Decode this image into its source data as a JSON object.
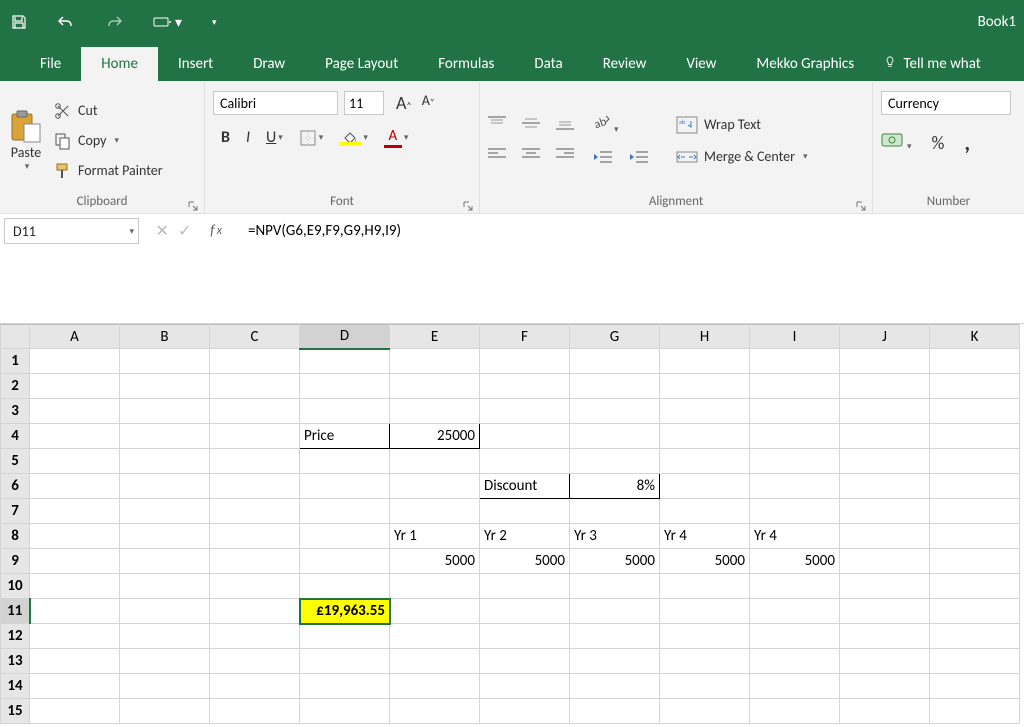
{
  "titlebar": {
    "doc": "Book1"
  },
  "tabs": {
    "file": "File",
    "home": "Home",
    "insert": "Insert",
    "draw": "Draw",
    "page_layout": "Page Layout",
    "formulas": "Formulas",
    "data": "Data",
    "review": "Review",
    "view": "View",
    "mekko": "Mekko Graphics",
    "tell": "Tell me what"
  },
  "ribbon": {
    "clipboard": {
      "paste": "Paste",
      "cut": "Cut",
      "copy": "Copy",
      "painter": "Format Painter",
      "label": "Clipboard"
    },
    "font": {
      "name": "Calibri",
      "size": "11",
      "label": "Font"
    },
    "alignment": {
      "wrap": "Wrap Text",
      "merge": "Merge & Center",
      "label": "Alignment"
    },
    "number": {
      "format": "Currency",
      "label": "Number"
    }
  },
  "fbar": {
    "name": "D11",
    "formula": "=NPV(G6,E9,F9,G9,H9,I9)"
  },
  "columns": [
    "A",
    "B",
    "C",
    "D",
    "E",
    "F",
    "G",
    "H",
    "I",
    "J",
    "K"
  ],
  "rows": 15,
  "cells": {
    "D4": {
      "v": "Price",
      "al": "l",
      "border": true
    },
    "E4": {
      "v": "25000",
      "al": "r",
      "border": true
    },
    "F6": {
      "v": "Discount",
      "al": "l",
      "border": true
    },
    "G6": {
      "v": "8%",
      "al": "r",
      "border": true
    },
    "E8": {
      "v": "Yr 1",
      "al": "l"
    },
    "F8": {
      "v": "Yr 2",
      "al": "l"
    },
    "G8": {
      "v": "Yr 3",
      "al": "l"
    },
    "H8": {
      "v": "Yr 4",
      "al": "l"
    },
    "I8": {
      "v": "Yr 4",
      "al": "l"
    },
    "E9": {
      "v": "5000",
      "al": "r"
    },
    "F9": {
      "v": "5000",
      "al": "r"
    },
    "G9": {
      "v": "5000",
      "al": "r"
    },
    "H9": {
      "v": "5000",
      "al": "r"
    },
    "I9": {
      "v": "5000",
      "al": "r"
    },
    "D11": {
      "v": "£19,963.55",
      "al": "r",
      "sel": true
    }
  },
  "selected": {
    "col": "D",
    "row": "11"
  }
}
